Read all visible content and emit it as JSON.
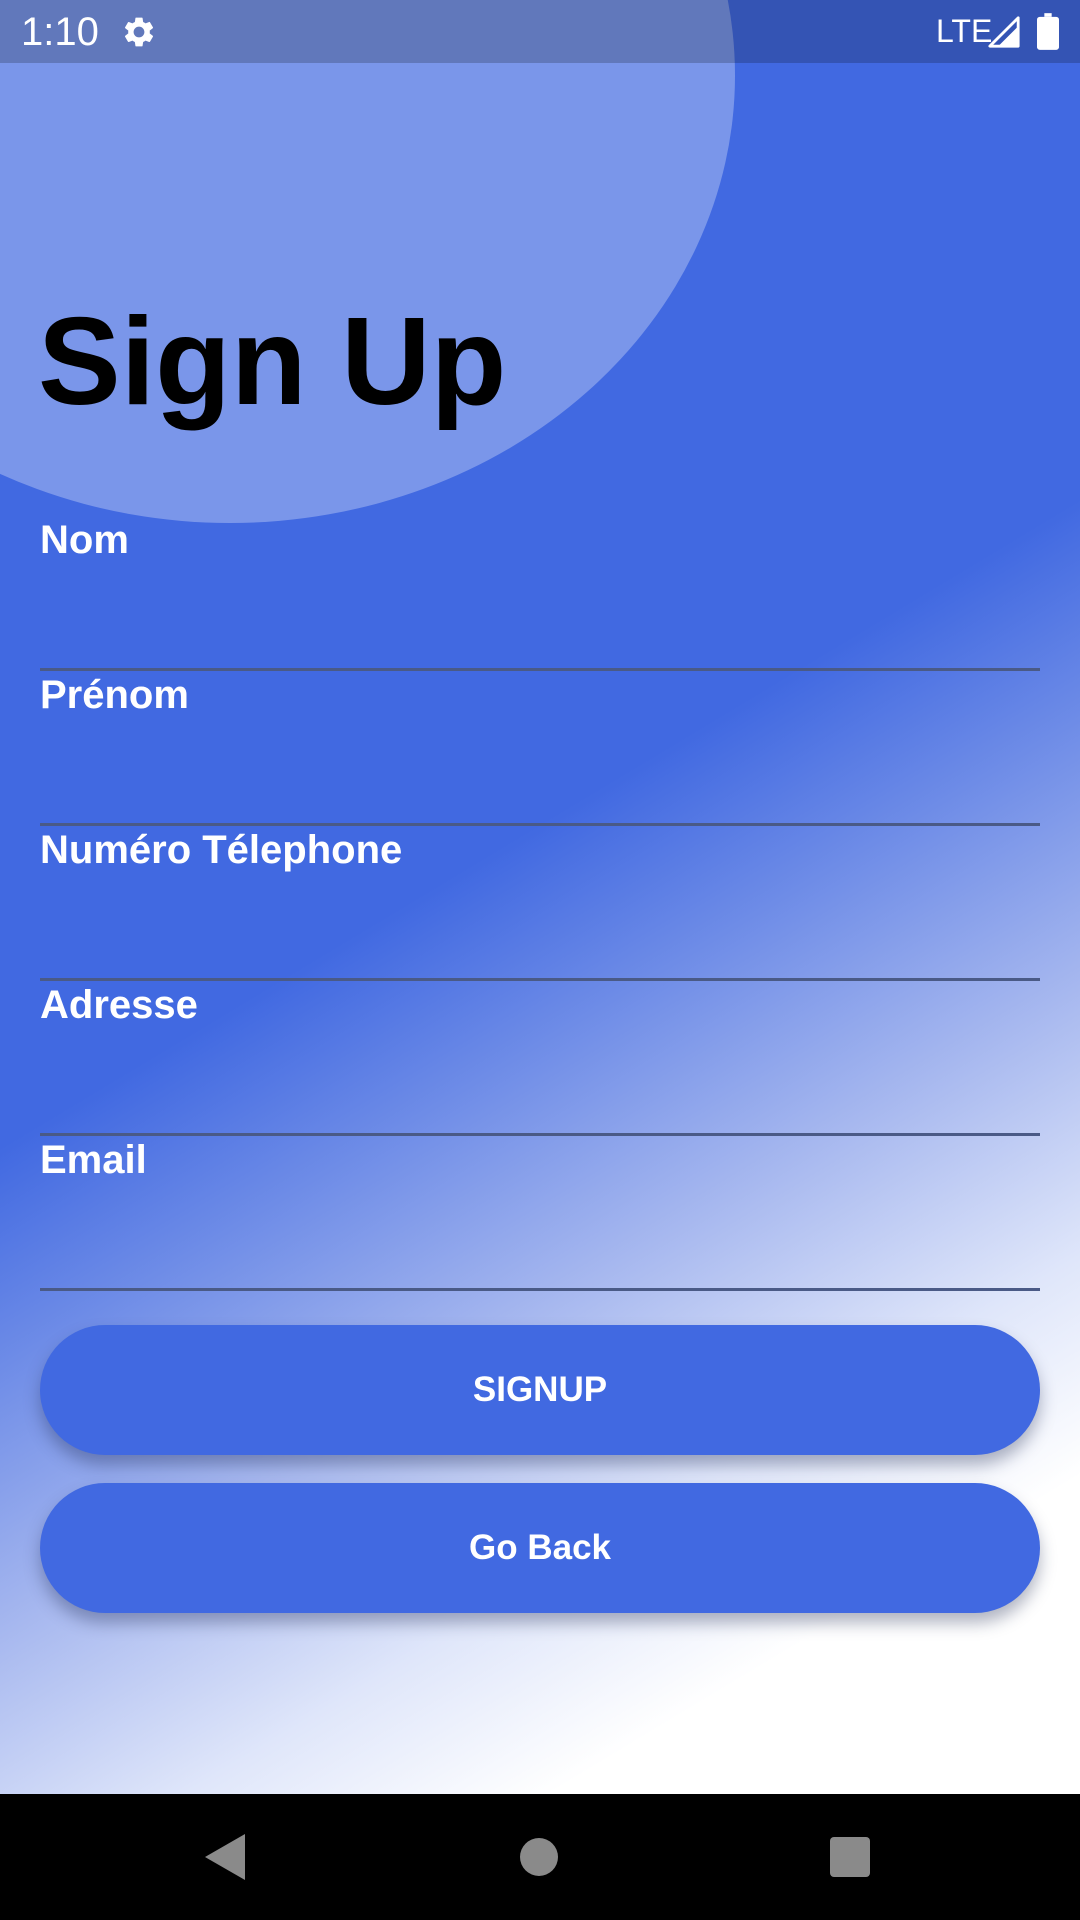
{
  "status_bar": {
    "time": "1:10",
    "network": "LTE",
    "icons": [
      "settings-icon",
      "cell-signal-icon",
      "battery-icon"
    ]
  },
  "page": {
    "title": "Sign Up"
  },
  "form": {
    "fields": [
      {
        "label": "Nom",
        "value": ""
      },
      {
        "label": "Prénom",
        "value": ""
      },
      {
        "label": "Numéro Télephone",
        "value": ""
      },
      {
        "label": "Adresse",
        "value": ""
      },
      {
        "label": "Email",
        "value": ""
      }
    ]
  },
  "buttons": {
    "signup_label": "SIGNUP",
    "back_label": "Go Back"
  },
  "nav_bar": {
    "icons": [
      "back-icon",
      "home-icon",
      "recents-icon"
    ]
  },
  "colors": {
    "accent": "#4169e1",
    "title_text": "#000000",
    "label_text": "#ffffff"
  }
}
